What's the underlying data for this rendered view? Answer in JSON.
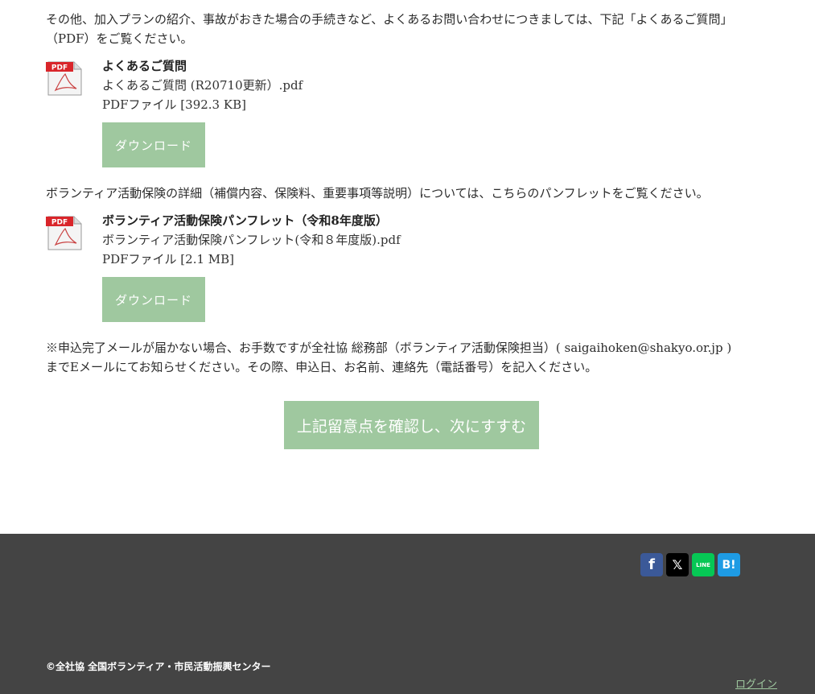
{
  "intro": {
    "line1": "その他、加入プランの紹介、事故がおきた場合の手続きなど、よくあるお問い合わせにつきましては、下記「よくあるご質問」",
    "line2": "（PDF）をご覧ください。"
  },
  "files": [
    {
      "title": "よくあるご質問",
      "filename": "よくあるご質問 (R20710更新）.pdf",
      "meta": "PDFファイル [392.3 KB]",
      "icon_label": "PDF",
      "download_label": "ダウンロード"
    },
    {
      "title": "ボランティア活動保険パンフレット（令和8年度版）",
      "filename": "ボランティア活動保険パンフレット(令和８年度版).pdf",
      "meta": "PDFファイル [2.1 MB]",
      "icon_label": "PDF",
      "download_label": "ダウンロード"
    }
  ],
  "details": {
    "text": "ボランティア活動保険の詳細（補償内容、保険料、重要事項等説明）については、こちらのパンフレットをご覧ください。"
  },
  "notice": {
    "line1": "※申込完了メールが届かない場合、お手数ですが全社協 総務部（ボランティア活動保険担当）( saigaihoken@shakyo.or.jp )",
    "line2": "までEメールにてお知らせください。その際、申込日、お名前、連絡先（電話番号）を記入ください。"
  },
  "next_button": {
    "label": "上記留意点を確認し、次にすすむ"
  },
  "footer": {
    "social": [
      {
        "name": "facebook-icon",
        "glyph": "f"
      },
      {
        "name": "x-icon",
        "glyph": "𝕏"
      },
      {
        "name": "line-icon",
        "glyph": "LINE"
      },
      {
        "name": "hatena-bookmark-icon",
        "glyph": "B!"
      }
    ],
    "copyright": "©全社協 全国ボランティア・市民活動振興センター",
    "login": "ログイン"
  },
  "colors": {
    "accent_green": "#9fc89f",
    "footer_bg": "#444444",
    "pdf_red": "#d9252a"
  }
}
